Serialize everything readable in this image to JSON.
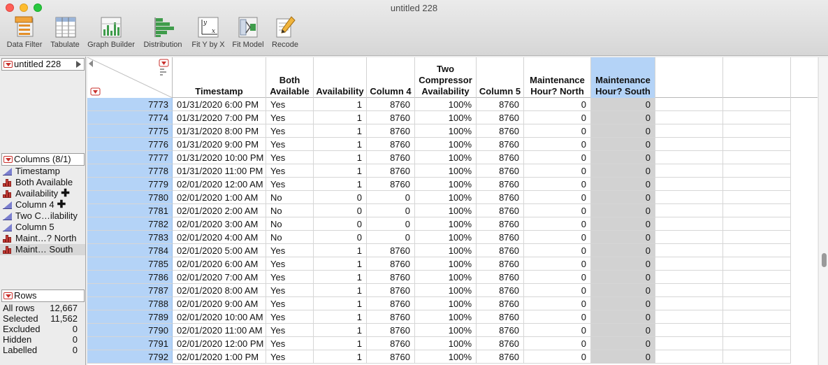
{
  "window": {
    "title": "untitled 228"
  },
  "toolbar": [
    {
      "label": "Data Filter",
      "icon": "data-filter-icon"
    },
    {
      "label": "Tabulate",
      "icon": "tabulate-icon"
    },
    {
      "label": "Graph Builder",
      "icon": "graph-builder-icon"
    },
    {
      "label": "Distribution",
      "icon": "distribution-icon"
    },
    {
      "label": "Fit Y by X",
      "icon": "fit-y-by-x-icon"
    },
    {
      "label": "Fit Model",
      "icon": "fit-model-icon"
    },
    {
      "label": "Recode",
      "icon": "recode-icon"
    }
  ],
  "table_panel": {
    "name": "untitled 228"
  },
  "columns_panel": {
    "title": "Columns (8/1)",
    "items": [
      {
        "label": "Timestamp",
        "type": "continuous",
        "plus": false,
        "selected": false
      },
      {
        "label": "Both Available",
        "type": "nominal",
        "plus": false,
        "selected": false
      },
      {
        "label": "Availability",
        "type": "nominal",
        "plus": true,
        "selected": false
      },
      {
        "label": "Column 4",
        "type": "continuous",
        "plus": true,
        "selected": false
      },
      {
        "label": "Two C…ilability",
        "type": "continuous",
        "plus": false,
        "selected": false
      },
      {
        "label": "Column 5",
        "type": "continuous",
        "plus": false,
        "selected": false
      },
      {
        "label": "Maint…? North",
        "type": "nominal",
        "plus": false,
        "selected": false
      },
      {
        "label": "Maint… South",
        "type": "nominal",
        "plus": false,
        "selected": true
      }
    ]
  },
  "rows_panel": {
    "title": "Rows",
    "stats": [
      {
        "label": "All rows",
        "value": "12,667"
      },
      {
        "label": "Selected",
        "value": "11,562"
      },
      {
        "label": "Excluded",
        "value": "0"
      },
      {
        "label": "Hidden",
        "value": "0"
      },
      {
        "label": "Labelled",
        "value": "0"
      }
    ]
  },
  "grid": {
    "headers": [
      {
        "lines": [
          "Timestamp"
        ],
        "selected": false
      },
      {
        "lines": [
          "Both",
          "Available"
        ],
        "selected": false
      },
      {
        "lines": [
          "Availability"
        ],
        "selected": false
      },
      {
        "lines": [
          "Column 4"
        ],
        "selected": false
      },
      {
        "lines": [
          "Two",
          "Compressor",
          "Availability"
        ],
        "selected": false
      },
      {
        "lines": [
          "Column 5"
        ],
        "selected": false
      },
      {
        "lines": [
          "Maintenance",
          "Hour? North"
        ],
        "selected": false
      },
      {
        "lines": [
          "Maintenance",
          "Hour? South"
        ],
        "selected": true
      },
      {
        "lines": [
          ""
        ],
        "selected": false
      },
      {
        "lines": [
          ""
        ],
        "selected": false
      }
    ],
    "rows": [
      [
        "7773",
        "01/31/2020 6:00 PM",
        "Yes",
        "1",
        "8760",
        "100%",
        "8760",
        "0",
        "0"
      ],
      [
        "7774",
        "01/31/2020 7:00 PM",
        "Yes",
        "1",
        "8760",
        "100%",
        "8760",
        "0",
        "0"
      ],
      [
        "7775",
        "01/31/2020 8:00 PM",
        "Yes",
        "1",
        "8760",
        "100%",
        "8760",
        "0",
        "0"
      ],
      [
        "7776",
        "01/31/2020 9:00 PM",
        "Yes",
        "1",
        "8760",
        "100%",
        "8760",
        "0",
        "0"
      ],
      [
        "7777",
        "01/31/2020 10:00 PM",
        "Yes",
        "1",
        "8760",
        "100%",
        "8760",
        "0",
        "0"
      ],
      [
        "7778",
        "01/31/2020 11:00 PM",
        "Yes",
        "1",
        "8760",
        "100%",
        "8760",
        "0",
        "0"
      ],
      [
        "7779",
        "02/01/2020 12:00 AM",
        "Yes",
        "1",
        "8760",
        "100%",
        "8760",
        "0",
        "0"
      ],
      [
        "7780",
        "02/01/2020 1:00 AM",
        "No",
        "0",
        "0",
        "100%",
        "8760",
        "0",
        "0"
      ],
      [
        "7781",
        "02/01/2020 2:00 AM",
        "No",
        "0",
        "0",
        "100%",
        "8760",
        "0",
        "0"
      ],
      [
        "7782",
        "02/01/2020 3:00 AM",
        "No",
        "0",
        "0",
        "100%",
        "8760",
        "0",
        "0"
      ],
      [
        "7783",
        "02/01/2020 4:00 AM",
        "No",
        "0",
        "0",
        "100%",
        "8760",
        "0",
        "0"
      ],
      [
        "7784",
        "02/01/2020 5:00 AM",
        "Yes",
        "1",
        "8760",
        "100%",
        "8760",
        "0",
        "0"
      ],
      [
        "7785",
        "02/01/2020 6:00 AM",
        "Yes",
        "1",
        "8760",
        "100%",
        "8760",
        "0",
        "0"
      ],
      [
        "7786",
        "02/01/2020 7:00 AM",
        "Yes",
        "1",
        "8760",
        "100%",
        "8760",
        "0",
        "0"
      ],
      [
        "7787",
        "02/01/2020 8:00 AM",
        "Yes",
        "1",
        "8760",
        "100%",
        "8760",
        "0",
        "0"
      ],
      [
        "7788",
        "02/01/2020 9:00 AM",
        "Yes",
        "1",
        "8760",
        "100%",
        "8760",
        "0",
        "0"
      ],
      [
        "7789",
        "02/01/2020 10:00 AM",
        "Yes",
        "1",
        "8760",
        "100%",
        "8760",
        "0",
        "0"
      ],
      [
        "7790",
        "02/01/2020 11:00 AM",
        "Yes",
        "1",
        "8760",
        "100%",
        "8760",
        "0",
        "0"
      ],
      [
        "7791",
        "02/01/2020 12:00 PM",
        "Yes",
        "1",
        "8760",
        "100%",
        "8760",
        "0",
        "0"
      ],
      [
        "7792",
        "02/01/2020 1:00 PM",
        "Yes",
        "1",
        "8760",
        "100%",
        "8760",
        "0",
        "0"
      ]
    ]
  },
  "colors": {
    "selection_blue": "#b4d3f7",
    "selected_cell_gray": "#d2d2d2",
    "jmp_red": "#c9302c"
  }
}
